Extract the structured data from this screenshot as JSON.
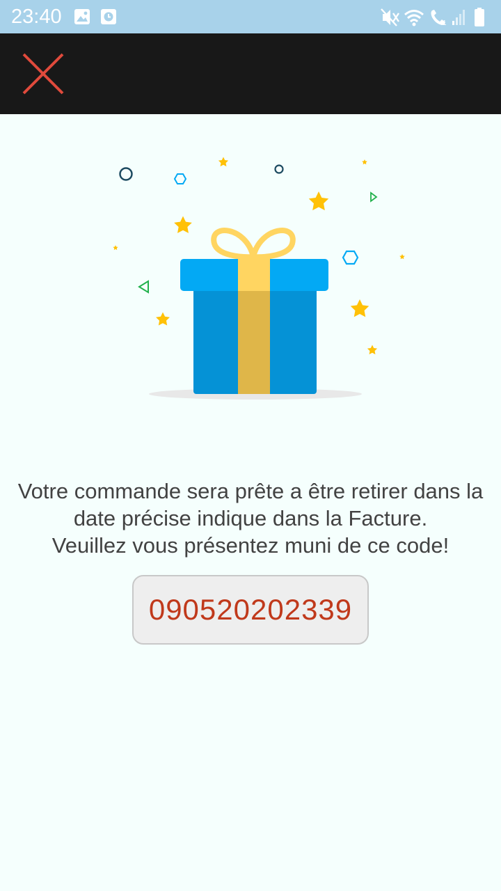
{
  "status_bar": {
    "time": "23:40",
    "left_icons": [
      "image-icon",
      "clock-icon"
    ],
    "right_icons": [
      "mute-icon",
      "wifi-icon",
      "wifi-calling-icon",
      "signal-icon",
      "battery-icon"
    ]
  },
  "toolbar": {
    "close_icon": "close-icon"
  },
  "illustration": {
    "icon": "gift-icon",
    "colors": {
      "box": "#0592d6",
      "lid": "#03a9f4",
      "ribbon": "#ffd561",
      "star": "#ffc107"
    }
  },
  "message": {
    "line1": "Votre commande sera prête a être retirer dans la",
    "line2": "date précise indique dans la Facture.",
    "line3": "Veuillez vous présentez muni de ce code!"
  },
  "pickup_code": "090520202339",
  "colors": {
    "status_bar": "#a8d2ea",
    "toolbar": "#181818",
    "close_icon": "#e04a3c",
    "background": "#f5fffd",
    "code_text": "#c0391b"
  }
}
